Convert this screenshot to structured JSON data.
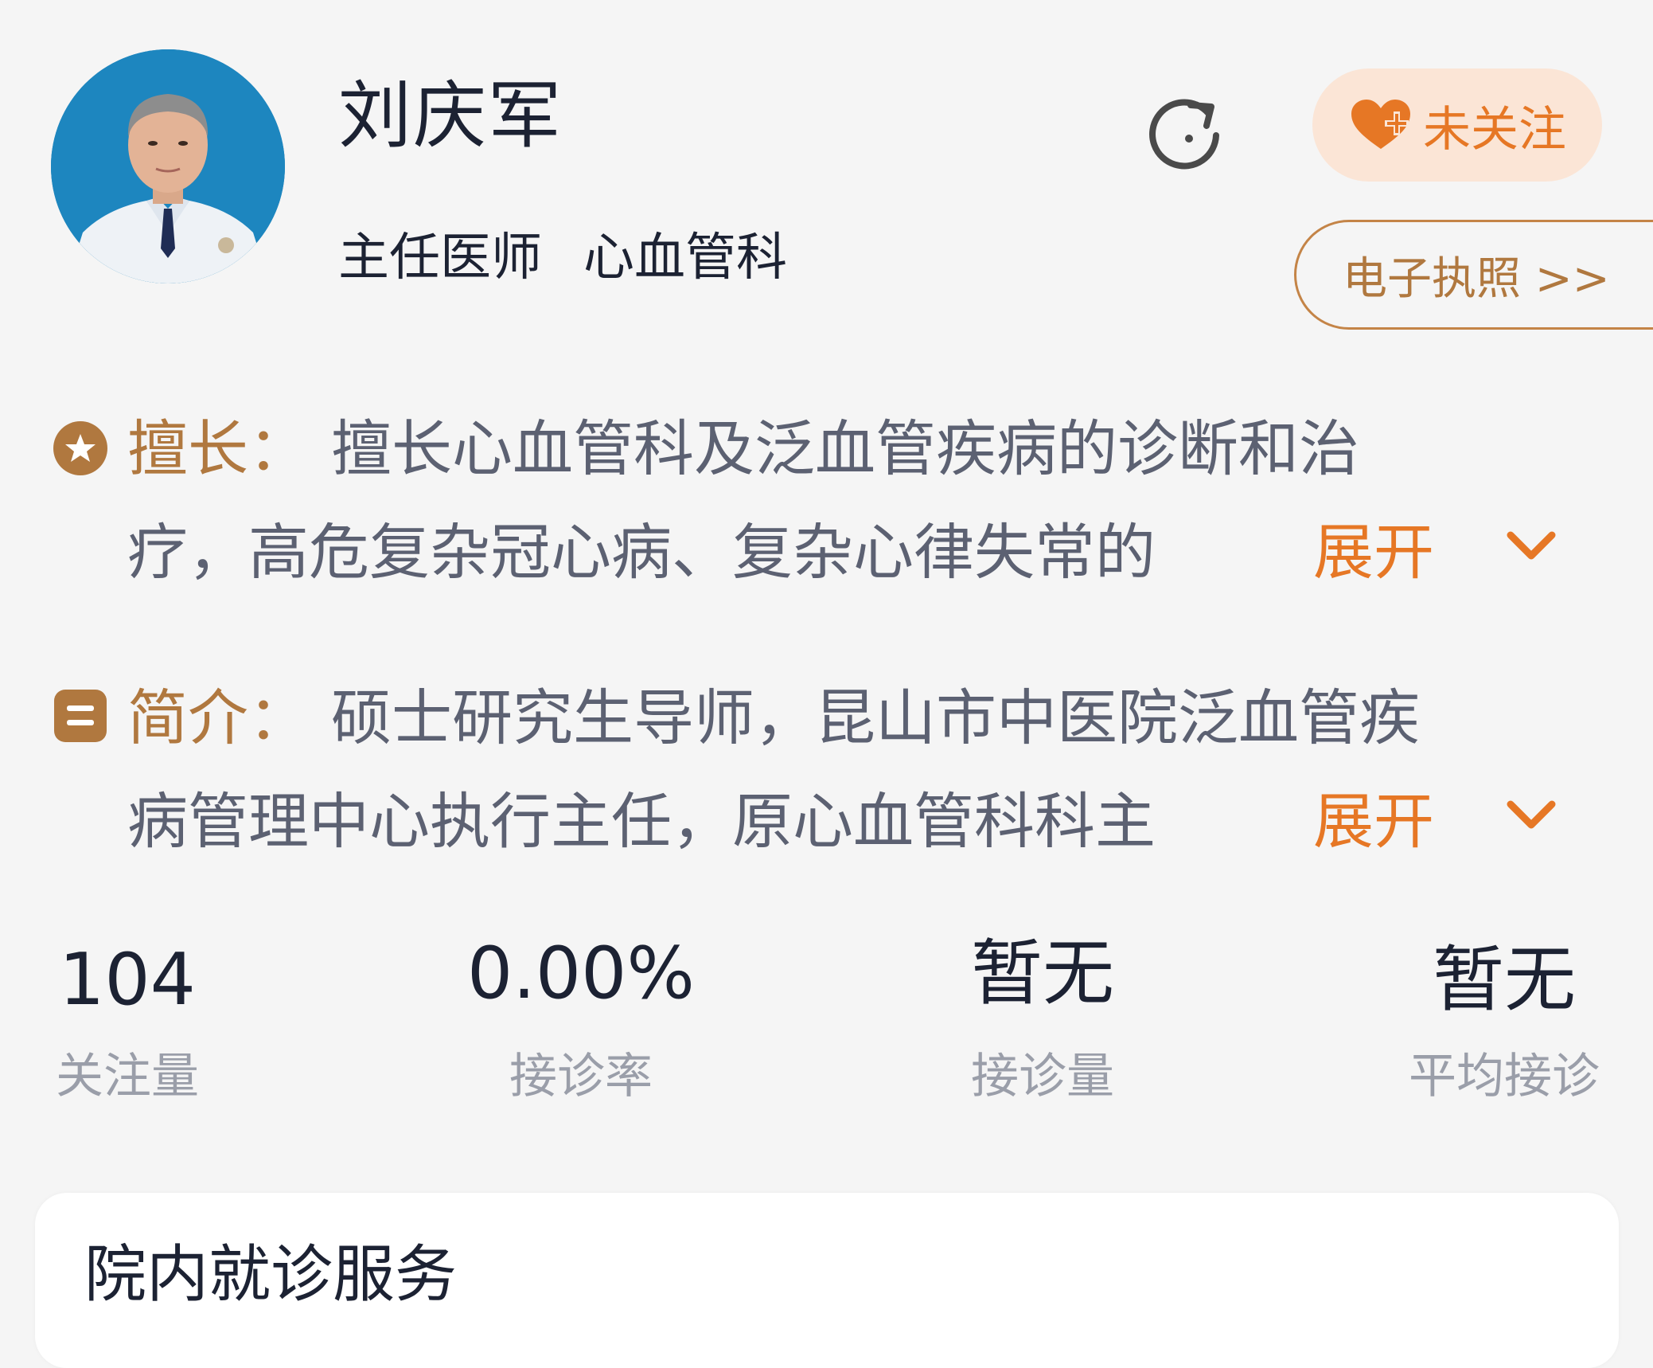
{
  "doctor": {
    "name": "刘庆军",
    "title": "主任医师",
    "department": "心血管科"
  },
  "actions": {
    "follow_label": "未关注",
    "license_label": "电子执照 >>"
  },
  "specialty": {
    "label": "擅长：",
    "line1": "擅长心血管科及泛血管疾病的诊断和治",
    "line2": "疗，高危复杂冠心病、复杂心律失常的",
    "expand_label": "展开"
  },
  "intro": {
    "label": "简介：",
    "line1": "硕士研究生导师，昆山市中医院泛血管疾",
    "line2": "病管理中心执行主任，原心血管科科主",
    "expand_label": "展开"
  },
  "stats": [
    {
      "value": "104",
      "label": "关注量"
    },
    {
      "value": "0.00%",
      "label": "接诊率"
    },
    {
      "value": "暂无",
      "label": "接诊量"
    },
    {
      "value": "暂无",
      "label": "平均接诊"
    }
  ],
  "service_card": {
    "title": "院内就诊服务"
  },
  "colors": {
    "accent_orange": "#e67725",
    "label_brown": "#b0783f",
    "follow_bg": "#fbe5d6",
    "text_dark": "#1c2233",
    "text_gray": "#5c6172",
    "muted": "#9a9ea9"
  },
  "icons": {
    "refresh": "refresh-icon",
    "follow": "heart-plus-icon",
    "specialty": "star-badge-icon",
    "intro": "document-icon",
    "expand": "chevron-down-icon"
  }
}
